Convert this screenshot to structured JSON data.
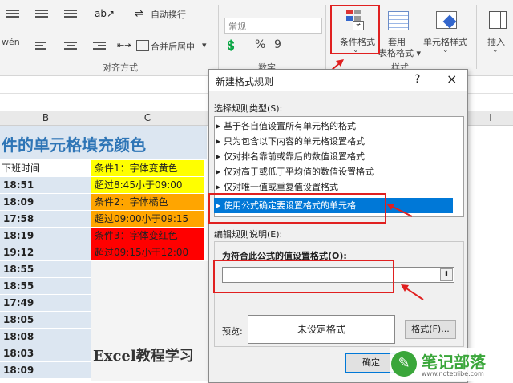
{
  "ribbon": {
    "wrap_text": "自动换行",
    "merge_center": "合并后居中",
    "number_format": "常规",
    "percent": "%",
    "comma": "9",
    "cond_format": "条件格式",
    "table_format": "套用\n表格格式",
    "cell_style": "单元格样式",
    "insert": "插入",
    "group_alignment": "对齐方式",
    "group_number": "数字",
    "group_style": "样式",
    "left_label": "wén"
  },
  "sheet": {
    "columns": [
      "B",
      "C",
      "I"
    ],
    "title": "件的单元格填充颜色",
    "header_b": "下班时间",
    "times": [
      "18:51",
      "18:09",
      "17:58",
      "18:19",
      "19:12",
      "18:55",
      "18:55",
      "17:49",
      "18:05",
      "18:08",
      "18:03",
      "18:09"
    ],
    "conditions": [
      {
        "text": "条件1：字体变黄色",
        "bg": "#ffff00"
      },
      {
        "text": "超过8:45小于09:00",
        "bg": "#ffff00"
      },
      {
        "text": "条件2：字体橘色",
        "bg": "#ffa500"
      },
      {
        "text": "超过09:00小于09:15",
        "bg": "#ffa500"
      },
      {
        "text": "条件3：字体变红色",
        "bg": "#ff0000"
      },
      {
        "text": "超过09:15小于12:00",
        "bg": "#ff0000"
      }
    ],
    "watermark": "Excel教程学习"
  },
  "dialog": {
    "title": "新建格式规则",
    "help": "?",
    "close": "×",
    "select_type_label": "选择规则类型(S):",
    "rules": [
      "基于各自值设置所有单元格的格式",
      "只为包含以下内容的单元格设置格式",
      "仅对排名靠前或靠后的数值设置格式",
      "仅对高于或低于平均值的数值设置格式",
      "仅对唯一值或重复值设置格式",
      "使用公式确定要设置格式的单元格"
    ],
    "selected_rule_index": 5,
    "edit_desc_label": "编辑规则说明(E):",
    "formula_label": "为符合此公式的值设置格式(O):",
    "formula_value": "",
    "preview_label": "预览:",
    "preview_text": "未设定格式",
    "format_button": "格式(F)...",
    "ok_button": "确定"
  },
  "logo": {
    "name": "笔记部落",
    "url": "www.notetribe.com"
  },
  "colors": {
    "accent_red": "#e02020",
    "selection_blue": "#0078d7",
    "title_blue": "#2e75b6",
    "logo_green": "#3aa63a"
  }
}
